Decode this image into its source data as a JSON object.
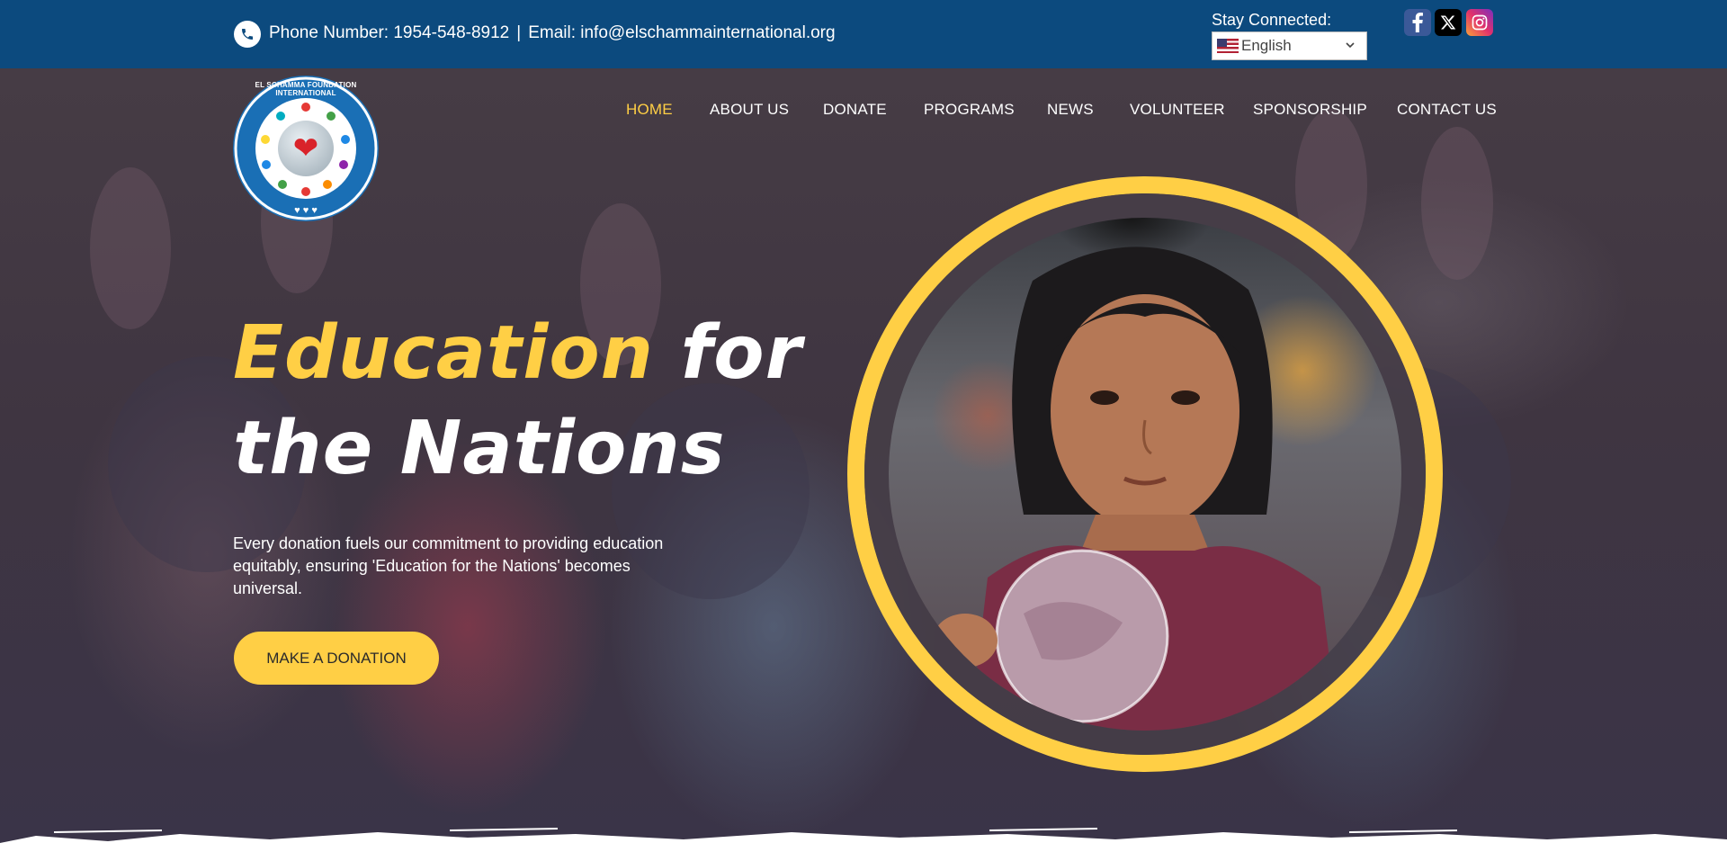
{
  "topbar": {
    "phone_text": "Phone Number: 1954-548-8912",
    "separator": "|",
    "email_text": "Email: info@elschammainternational.org",
    "stay_connected": "Stay Connected:",
    "language_selected": "English",
    "social_icons": [
      "facebook-icon",
      "x-twitter-icon",
      "instagram-icon"
    ]
  },
  "logo": {
    "ring_text": "EL SCHAMMA FOUNDATION INTERNATIONAL"
  },
  "nav": {
    "items": [
      "HOME",
      "ABOUT US",
      "DONATE",
      "PROGRAMS",
      "NEWS",
      "VOLUNTEER",
      "SPONSORSHIP",
      "CONTACT US"
    ],
    "active": "HOME"
  },
  "hero": {
    "headline_highlight": "Education",
    "headline_rest": "for",
    "headline_line2": "the Nations",
    "description": "Every donation fuels our commitment to providing education equitably, ensuring 'Education for the Nations' becomes universal.",
    "cta_label": "MAKE A DONATION"
  },
  "colors": {
    "topbar_bg": "#0c4a7e",
    "accent_yellow": "#ffcf45",
    "text_white": "#ffffff"
  }
}
